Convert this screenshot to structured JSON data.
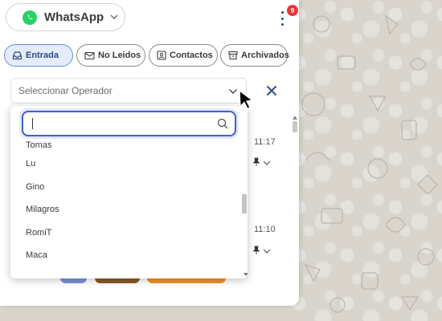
{
  "header": {
    "app_name": "WhatsApp",
    "notification_count": "9"
  },
  "tabs": [
    {
      "label": "Entrada",
      "icon": "inbox-icon",
      "active": true
    },
    {
      "label": "No Leidos",
      "icon": "envelope-icon",
      "active": false
    },
    {
      "label": "Contactos",
      "icon": "contact-card-icon",
      "active": false
    },
    {
      "label": "Archivados",
      "icon": "archive-icon",
      "active": false
    }
  ],
  "operator_select": {
    "placeholder": "Seleccionar Operador"
  },
  "dropdown": {
    "search_value": "",
    "options": [
      "Tomas",
      "Lu",
      "Gino",
      "Milagros",
      "RomiT",
      "Maca"
    ]
  },
  "background_list": {
    "times": [
      "11:17",
      "11:10"
    ]
  },
  "colors": {
    "accent": "#4060c8",
    "whatsapp_green": "#25d366",
    "badge_red": "#e53935",
    "tag_blue": "#7d96d8",
    "tag_brown": "#8a5a2b",
    "tag_orange": "#f0922b"
  }
}
